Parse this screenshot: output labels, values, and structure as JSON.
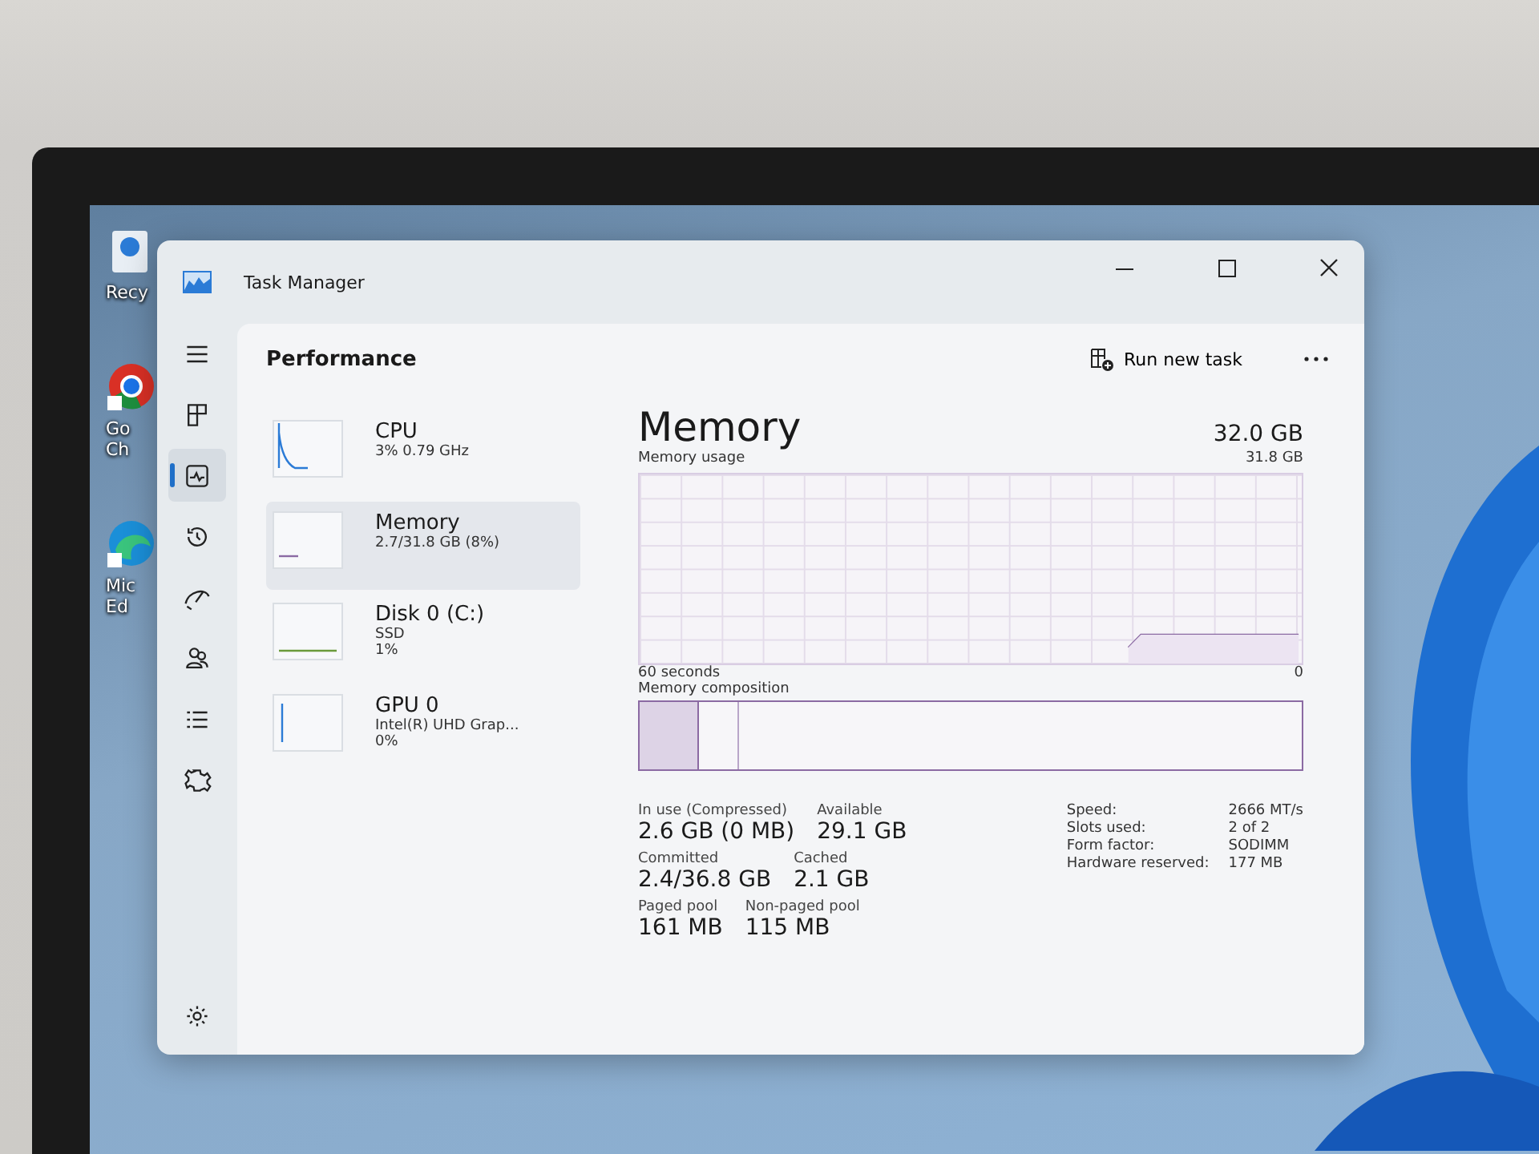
{
  "desktop": {
    "icons": [
      {
        "kind": "bin",
        "label": "Recy"
      },
      {
        "kind": "browser",
        "label": "Go Ch"
      },
      {
        "kind": "edge",
        "label": "Mic Ed"
      }
    ]
  },
  "window": {
    "title": "Task Manager"
  },
  "header": {
    "page_title": "Performance",
    "run_new_task": "Run new task"
  },
  "nav": [
    {
      "kind": "menu",
      "selected": false
    },
    {
      "kind": "processes",
      "selected": false
    },
    {
      "kind": "performance",
      "selected": true
    },
    {
      "kind": "history",
      "selected": false
    },
    {
      "kind": "startup",
      "selected": false
    },
    {
      "kind": "users",
      "selected": false
    },
    {
      "kind": "details",
      "selected": false
    },
    {
      "kind": "services",
      "selected": false
    },
    {
      "kind": "settings",
      "selected": false
    }
  ],
  "resources": [
    {
      "kind": "cpu",
      "name": "CPU",
      "details": [
        "3% 0.79 GHz"
      ],
      "selected": false
    },
    {
      "kind": "memory",
      "name": "Memory",
      "details": [
        "2.7/31.8 GB (8%)"
      ],
      "selected": true
    },
    {
      "kind": "disk",
      "name": "Disk 0 (C:)",
      "details": [
        "SSD",
        "1%"
      ],
      "selected": false
    },
    {
      "kind": "gpu",
      "name": "GPU 0",
      "details": [
        "Intel(R) UHD Grap...",
        "0%"
      ],
      "selected": false
    }
  ],
  "detail": {
    "title": "Memory",
    "capacity": "32.0 GB",
    "graph_label": "Memory usage",
    "graph_max": "31.8 GB",
    "time_span": "60 seconds",
    "graph_min": "0",
    "composition_label": "Memory composition",
    "stat_rows": [
      [
        {
          "label": "In use (Compressed)",
          "value": "2.6 GB (0 MB)"
        },
        {
          "label": "Available",
          "value": "29.1 GB"
        }
      ],
      [
        {
          "label": "Committed",
          "value": "2.4/36.8 GB"
        },
        {
          "label": "Cached",
          "value": "2.1 GB"
        }
      ],
      [
        {
          "label": "Paged pool",
          "value": "161 MB"
        },
        {
          "label": "Non-paged pool",
          "value": "115 MB"
        }
      ]
    ],
    "specs": [
      {
        "label": "Speed:",
        "value": "2666 MT/s"
      },
      {
        "label": "Slots used:",
        "value": "2 of 2"
      },
      {
        "label": "Form factor:",
        "value": "SODIMM"
      },
      {
        "label": "Hardware reserved:",
        "value": "177 MB"
      }
    ]
  }
}
